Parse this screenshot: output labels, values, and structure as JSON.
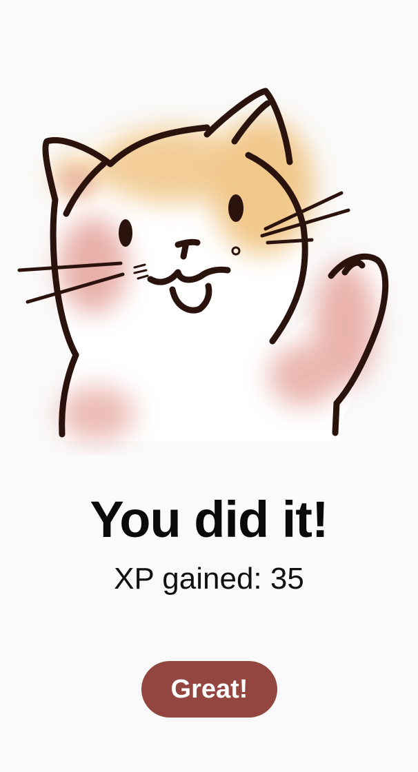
{
  "illustration": {
    "subject": "waving-cat-icon",
    "colors": {
      "outline": "#2a120d",
      "fur_orange": "#f0c890",
      "blush": "#e7a8a0",
      "body": "#ffffff"
    }
  },
  "result": {
    "title": "You did it!",
    "xp_text": "XP gained: 35"
  },
  "actions": {
    "confirm_label": "Great!"
  },
  "theme": {
    "background": "#fafafa",
    "button_color": "#934640",
    "button_text_color": "#ffffff",
    "title_color": "#0a0a0a"
  }
}
